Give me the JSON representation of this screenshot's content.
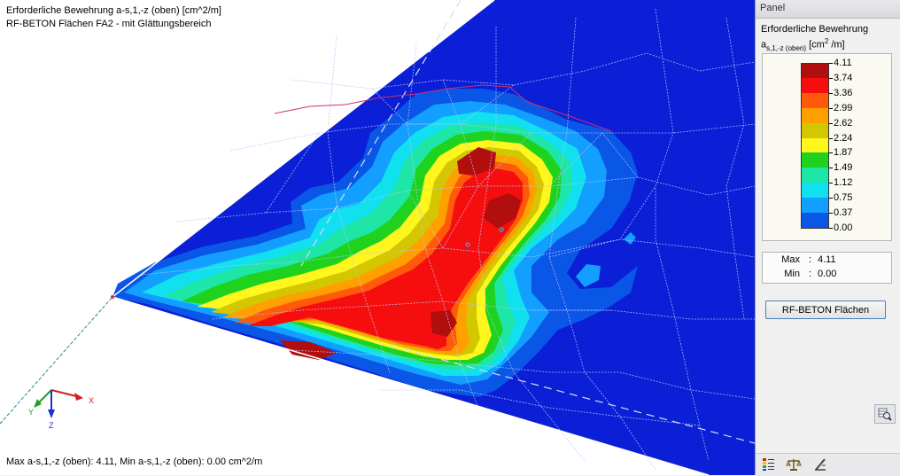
{
  "viewport": {
    "title_line1": "Erforderliche Bewehrung a-s,1,-z (oben) [cm^2/m]",
    "title_line2": "RF-BETON Flächen FA2 - mit Glättungsbereich",
    "status_text": "Max a-s,1,-z (oben): 4.11, Min a-s,1,-z (oben): 0.00 cm^2/m",
    "axes": {
      "x": "X",
      "y": "Y",
      "z": "Z"
    },
    "contour_colors": {
      "c0": "#0a1fd6",
      "c1": "#0a56e6",
      "c2": "#139fff",
      "c3": "#11e0ef",
      "c4": "#1ee6a6",
      "c5": "#1ed21e",
      "c6": "#fff61e",
      "c7": "#d4c600",
      "c8": "#ff9f00",
      "c9": "#ff5a0a",
      "c10": "#f60e0e",
      "c11": "#b10e0e"
    }
  },
  "panel": {
    "header": "Panel",
    "legend_title": "Erforderliche Bewehrung",
    "legend_symbol_main": "a",
    "legend_symbol_sub": "s,1,-z (oben)",
    "legend_unit_prefix": "[cm",
    "legend_unit_sup": "2",
    "legend_unit_suffix": " /m]",
    "legend": [
      {
        "value": "4.11",
        "color": "#b10e0e"
      },
      {
        "value": "3.74",
        "color": "#f60e0e"
      },
      {
        "value": "3.36",
        "color": "#ff5a0a"
      },
      {
        "value": "2.99",
        "color": "#ff9f00"
      },
      {
        "value": "2.62",
        "color": "#d4c600"
      },
      {
        "value": "2.24",
        "color": "#fff61e"
      },
      {
        "value": "1.87",
        "color": "#1ed21e"
      },
      {
        "value": "1.49",
        "color": "#1ee6a6"
      },
      {
        "value": "1.12",
        "color": "#11e0ef"
      },
      {
        "value": "0.75",
        "color": "#139fff"
      },
      {
        "value": "0.37",
        "color": "#0a56e6"
      },
      {
        "value": "0.00",
        "color": "#0a1fd6"
      }
    ],
    "max_label": "Max",
    "min_label": "Min",
    "separator": ":",
    "max_value": "4.11",
    "min_value": "0.00",
    "button_label": "RF-BETON Flächen"
  }
}
